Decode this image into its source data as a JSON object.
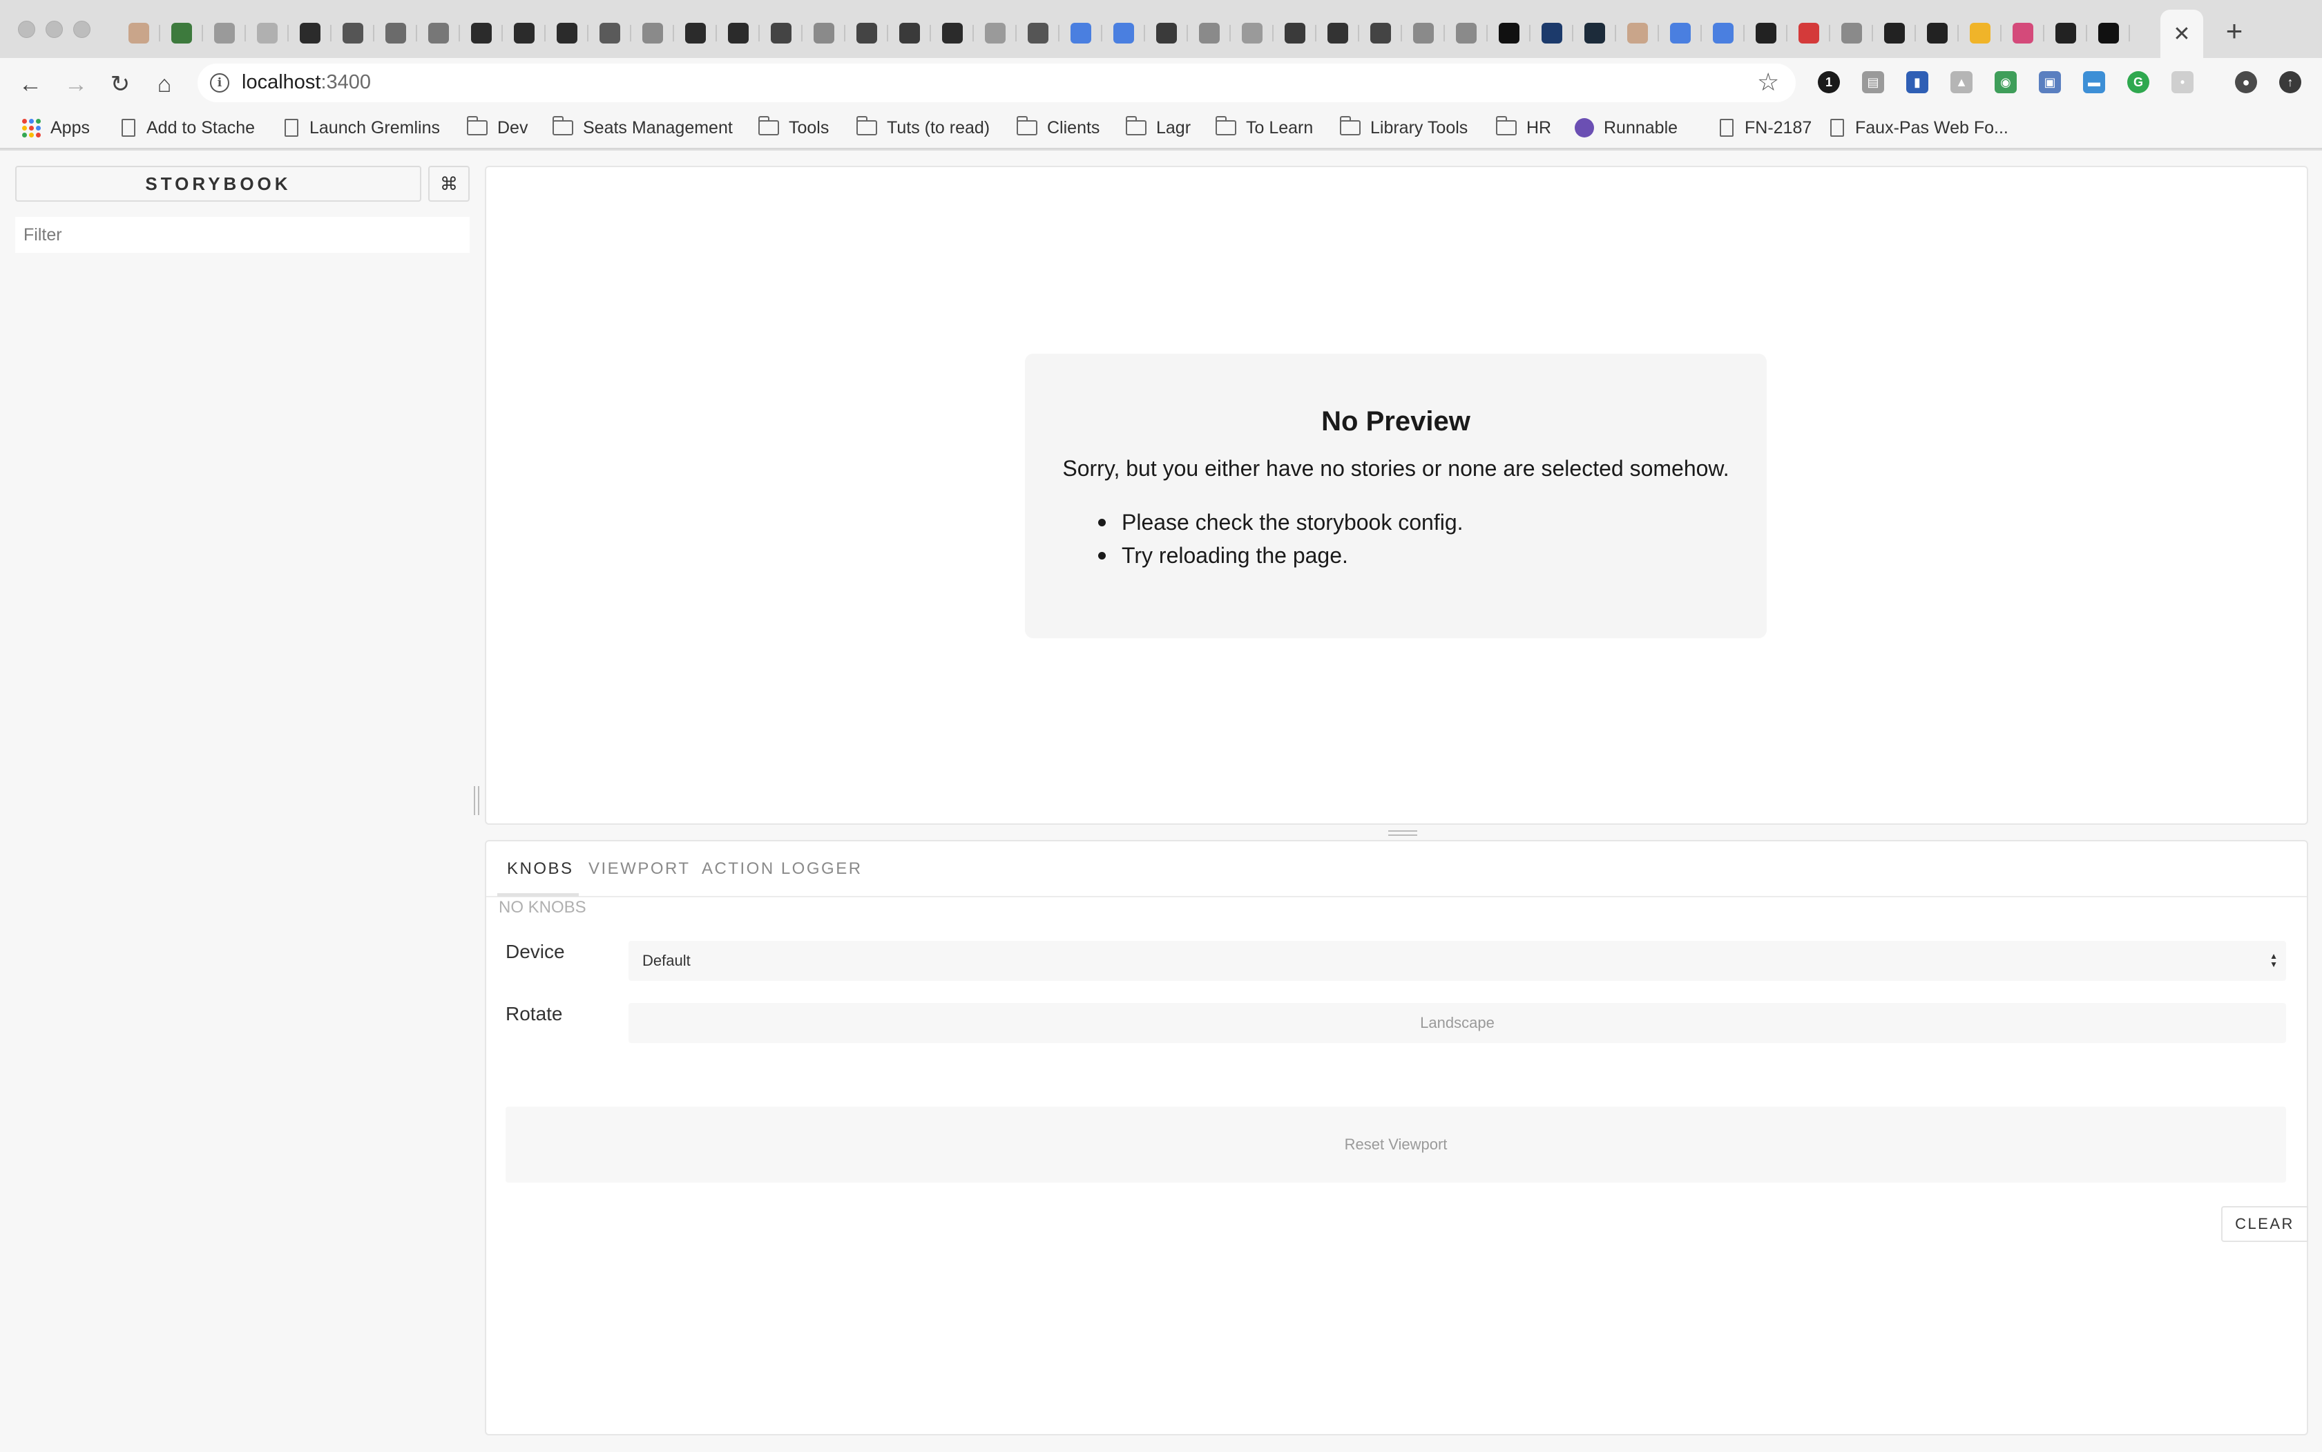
{
  "browser": {
    "url_host": "localhost",
    "url_port": ":3400",
    "tab_icons": [
      {
        "name": "avatar-favicon",
        "color": "#c9a58a"
      },
      {
        "name": "cube-favicon",
        "color": "#3d7a3d"
      },
      {
        "name": "page-favicon",
        "color": "#9a9a9a"
      },
      {
        "name": "arc-favicon",
        "color": "#b0b0b0"
      },
      {
        "name": "github-favicon",
        "color": "#2b2b2b"
      },
      {
        "name": "person-favicon",
        "color": "#555555"
      },
      {
        "name": "cy-favicon",
        "color": "#6b6b6b"
      },
      {
        "name": "hand-favicon",
        "color": "#777777"
      },
      {
        "name": "github-favicon",
        "color": "#2b2b2b"
      },
      {
        "name": "github-favicon",
        "color": "#2b2b2b"
      },
      {
        "name": "github-favicon",
        "color": "#2b2b2b"
      },
      {
        "name": "clock-favicon",
        "color": "#5a5a5a"
      },
      {
        "name": "triangle-favicon",
        "color": "#8a8a8a"
      },
      {
        "name": "github-favicon",
        "color": "#2b2b2b"
      },
      {
        "name": "github-favicon",
        "color": "#2b2b2b"
      },
      {
        "name": "scissors-favicon",
        "color": "#444444"
      },
      {
        "name": "triangle-favicon",
        "color": "#8a8a8a"
      },
      {
        "name": "scissors-favicon",
        "color": "#444444"
      },
      {
        "name": "octocat-favicon",
        "color": "#3a3a3a"
      },
      {
        "name": "github-favicon",
        "color": "#2b2b2b"
      },
      {
        "name": "page-favicon",
        "color": "#9a9a9a"
      },
      {
        "name": "star-favicon",
        "color": "#555555"
      },
      {
        "name": "docs-favicon",
        "color": "#4a7fe0"
      },
      {
        "name": "docs-favicon",
        "color": "#4a7fe0"
      },
      {
        "name": "octocat-favicon",
        "color": "#3a3a3a"
      },
      {
        "name": "avatar-favicon",
        "color": "#8a8a8a"
      },
      {
        "name": "page-favicon",
        "color": "#9a9a9a"
      },
      {
        "name": "octocat-favicon",
        "color": "#3a3a3a"
      },
      {
        "name": "bar-favicon",
        "color": "#333333"
      },
      {
        "name": "scissors-favicon",
        "color": "#444444"
      },
      {
        "name": "avatar-favicon",
        "color": "#8a8a8a"
      },
      {
        "name": "avatar-favicon",
        "color": "#8a8a8a"
      },
      {
        "name": "github-favicon",
        "color": "#111111"
      },
      {
        "name": "scissors-favicon",
        "color": "#1c3a6b"
      },
      {
        "name": "react-favicon",
        "color": "#1c2b3a"
      },
      {
        "name": "avatar-favicon",
        "color": "#c9a58a"
      },
      {
        "name": "docs-favicon",
        "color": "#4a7fe0"
      },
      {
        "name": "docs-favicon",
        "color": "#4a7fe0"
      },
      {
        "name": "octocat-favicon",
        "color": "#222222"
      },
      {
        "name": "bracket-favicon",
        "color": "#d43a3a"
      },
      {
        "name": "avatar-favicon",
        "color": "#8a8a8a"
      },
      {
        "name": "octocat-favicon",
        "color": "#222222"
      },
      {
        "name": "octocat-favicon",
        "color": "#222222"
      },
      {
        "name": "box-favicon",
        "color": "#f0b429"
      },
      {
        "name": "sm-favicon",
        "color": "#d44a7a"
      },
      {
        "name": "octocat-favicon",
        "color": "#222222"
      },
      {
        "name": "github-favicon",
        "color": "#111111"
      }
    ],
    "active_tab_close": "✕",
    "new_tab": "+",
    "nav": {
      "back": "←",
      "forward": "→",
      "reload": "↻",
      "home": "⌂",
      "info": "i",
      "bookmark_star": "☆"
    },
    "extensions": [
      {
        "name": "1password-icon",
        "glyph": "1",
        "color": "#1a1a1a"
      },
      {
        "name": "reader-icon",
        "glyph": "▤",
        "color": "#9a9a9a"
      },
      {
        "name": "bookmark-ext-icon",
        "glyph": "▮",
        "color": "#2f5fb5"
      },
      {
        "name": "drive-icon",
        "glyph": "▲",
        "color": "#b5b5b5"
      },
      {
        "name": "search-ext-icon",
        "glyph": "◉",
        "color": "#3f9e5a"
      },
      {
        "name": "window-ext-icon",
        "glyph": "▣",
        "color": "#5a7fc0"
      },
      {
        "name": "chat-ext-icon",
        "glyph": "▬",
        "color": "#3d8fd6"
      },
      {
        "name": "grammarly-icon",
        "glyph": "G",
        "color": "#2fa84f"
      },
      {
        "name": "disabled-ext-icon",
        "glyph": "•",
        "color": "#cfcfcf"
      },
      {
        "name": "profile-avatar",
        "glyph": "●",
        "color": "#4a4a4a"
      },
      {
        "name": "update-icon",
        "glyph": "↑",
        "color": "#3a3a3a"
      }
    ],
    "bookmarks": [
      {
        "label": "Apps",
        "icon": "apps-icon"
      },
      {
        "label": "Add to Stache",
        "icon": "page-icon"
      },
      {
        "label": "Launch Gremlins",
        "icon": "page-icon"
      },
      {
        "label": "Dev",
        "icon": "folder-icon"
      },
      {
        "label": "Seats Management",
        "icon": "folder-icon"
      },
      {
        "label": "Tools",
        "icon": "folder-icon"
      },
      {
        "label": "Tuts (to read)",
        "icon": "folder-icon"
      },
      {
        "label": "Clients",
        "icon": "folder-icon"
      },
      {
        "label": "Lagr",
        "icon": "folder-icon"
      },
      {
        "label": "To Learn",
        "icon": "folder-icon"
      },
      {
        "label": "Library Tools",
        "icon": "folder-icon"
      },
      {
        "label": "HR",
        "icon": "folder-icon"
      },
      {
        "label": "Runnable",
        "icon": "runnable-icon"
      },
      {
        "label": "FN-2187",
        "icon": "page-icon"
      },
      {
        "label": "Faux-Pas Web Fo...",
        "icon": "page-icon"
      }
    ]
  },
  "storybook": {
    "brand": "STORYBOOK",
    "shortcuts_glyph": "⌘",
    "filter_placeholder": "Filter",
    "preview": {
      "title": "No Preview",
      "message": "Sorry, but you either have no stories or none are selected somehow.",
      "tips": [
        "Please check the storybook config.",
        "Try reloading the page."
      ]
    },
    "panel": {
      "tabs": [
        "KNOBS",
        "VIEWPORT",
        "ACTION LOGGER"
      ],
      "active_tab": "KNOBS",
      "no_knobs": "NO KNOBS",
      "device_label": "Device",
      "device_value": "Default",
      "rotate_label": "Rotate",
      "rotate_button": "Landscape",
      "reset_button": "Reset Viewport",
      "clear_button": "CLEAR"
    }
  }
}
